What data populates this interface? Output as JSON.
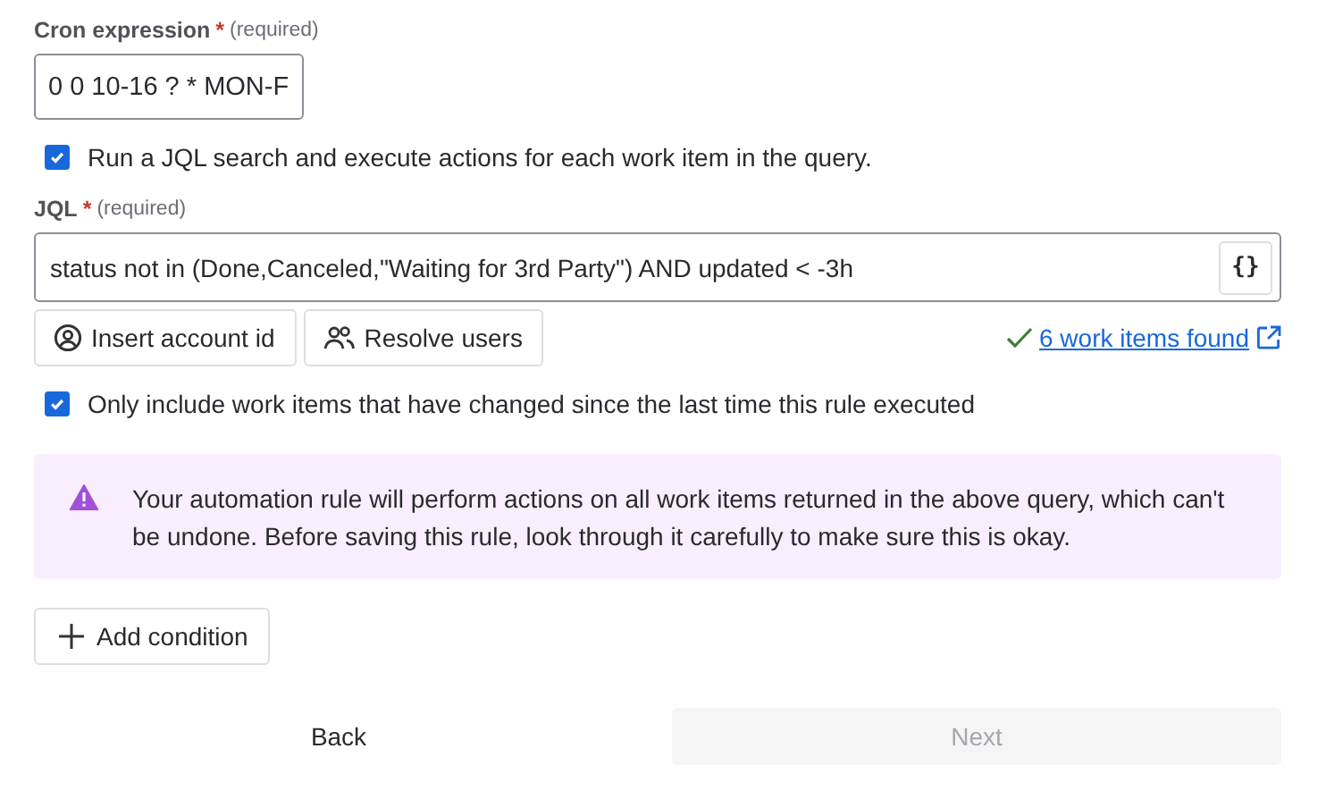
{
  "cron": {
    "label": "Cron expression",
    "required_mark": "*",
    "hint": "(required)",
    "value": "0 0 10-16 ? * MON-F"
  },
  "jql_search": {
    "label": "Run a JQL search and execute actions for each work item in the query.",
    "checked": true
  },
  "jql": {
    "label": "JQL",
    "required_mark": "*",
    "hint": "(required)",
    "value": "status not in (Done,Canceled,\"Waiting for 3rd Party\") AND updated < -3h",
    "format_button": "{}"
  },
  "jql_actions": [
    {
      "kind": "account",
      "label": "Insert account id"
    },
    {
      "kind": "users",
      "label": "Resolve users"
    }
  ],
  "found_link": "6 work items found",
  "only_changed": {
    "label": "Only include work items that have changed since the last time this rule executed",
    "checked": true
  },
  "warning": "Your automation rule will perform actions on all work items returned in the above query, which can't be undone. Before saving this rule, look through it carefully to make sure this is okay.",
  "add_condition": "Add condition",
  "footer": [
    {
      "label": "Back",
      "disabled": false
    },
    {
      "label": "Next",
      "disabled": true
    }
  ]
}
